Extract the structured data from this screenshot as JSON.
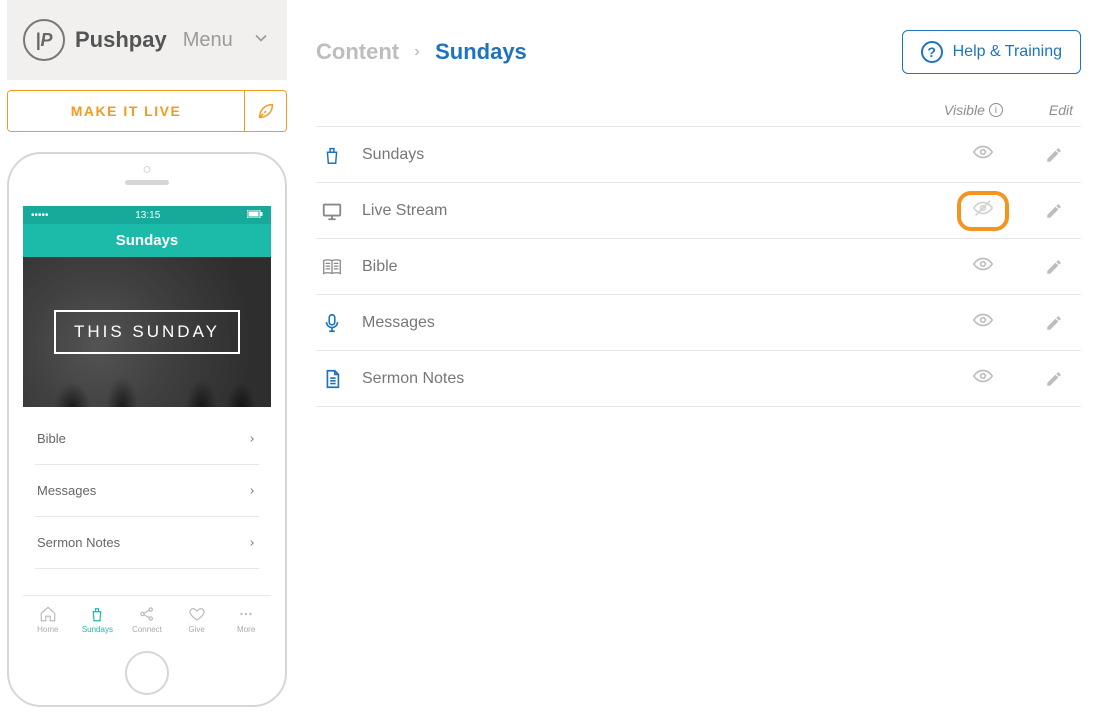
{
  "brand": {
    "name": "Pushpay",
    "menu_label": "Menu"
  },
  "make_live_label": "MAKE IT LIVE",
  "breadcrumb": {
    "parent": "Content",
    "current": "Sundays"
  },
  "help_label": "Help & Training",
  "table": {
    "col_visible": "Visible",
    "col_edit": "Edit"
  },
  "rows": [
    {
      "label": "Sundays",
      "icon": "podium",
      "visible": true,
      "highlight": false
    },
    {
      "label": "Live Stream",
      "icon": "monitor",
      "visible": false,
      "highlight": true
    },
    {
      "label": "Bible",
      "icon": "book",
      "visible": true,
      "highlight": false
    },
    {
      "label": "Messages",
      "icon": "mic",
      "visible": true,
      "highlight": false
    },
    {
      "label": "Sermon Notes",
      "icon": "document",
      "visible": true,
      "highlight": false
    }
  ],
  "phone": {
    "status_left": "•••••",
    "status_time": "13:15",
    "title": "Sundays",
    "hero_label": "THIS SUNDAY",
    "list": [
      {
        "label": "Bible"
      },
      {
        "label": "Messages"
      },
      {
        "label": "Sermon Notes"
      }
    ],
    "tabs": [
      {
        "label": "Home",
        "icon": "home",
        "active": false
      },
      {
        "label": "Sundays",
        "icon": "podium",
        "active": true
      },
      {
        "label": "Connect",
        "icon": "share",
        "active": false
      },
      {
        "label": "Give",
        "icon": "heart",
        "active": false
      },
      {
        "label": "More",
        "icon": "dots",
        "active": false
      }
    ]
  },
  "colors": {
    "accent_blue": "#1e73be",
    "accent_orange": "#f5941f",
    "accent_teal": "#1bbaa9"
  }
}
